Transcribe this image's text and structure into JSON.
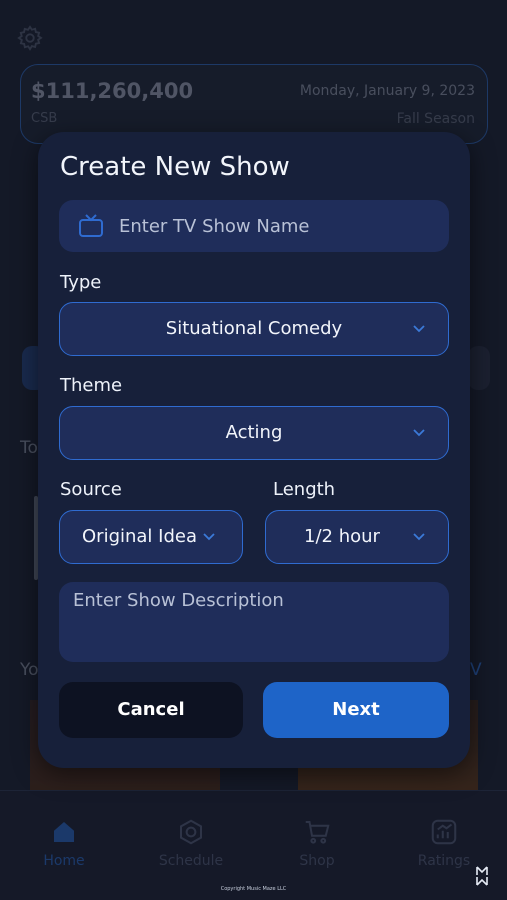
{
  "background": {
    "balance": "$111,260,400",
    "network": "CSB",
    "date": "Monday, January 9, 2023",
    "season": "Fall Season",
    "fragment_to": "To",
    "fragment_yo": "Yo",
    "fragment_link": "V"
  },
  "modal": {
    "title": "Create New Show",
    "name_placeholder": "Enter TV Show Name",
    "type_label": "Type",
    "type_value": "Situational Comedy",
    "theme_label": "Theme",
    "theme_value": "Acting",
    "source_label": "Source",
    "source_value": "Original Idea",
    "length_label": "Length",
    "length_value": "1/2 hour",
    "description_placeholder": "Enter Show Description",
    "cancel_label": "Cancel",
    "next_label": "Next"
  },
  "nav": {
    "items": [
      {
        "label": "Home",
        "icon": "home-icon",
        "active": true
      },
      {
        "label": "Schedule",
        "icon": "schedule-icon",
        "active": false
      },
      {
        "label": "Shop",
        "icon": "cart-icon",
        "active": false
      },
      {
        "label": "Ratings",
        "icon": "ratings-icon",
        "active": false
      }
    ]
  },
  "footer": {
    "copyright": "Copyright Music Maze LLC",
    "logo": "M"
  },
  "colors": {
    "accent": "#1e64c8",
    "modal_bg": "#17203a",
    "field_bg": "#1f2d5a",
    "field_border": "#2f6bd0"
  }
}
